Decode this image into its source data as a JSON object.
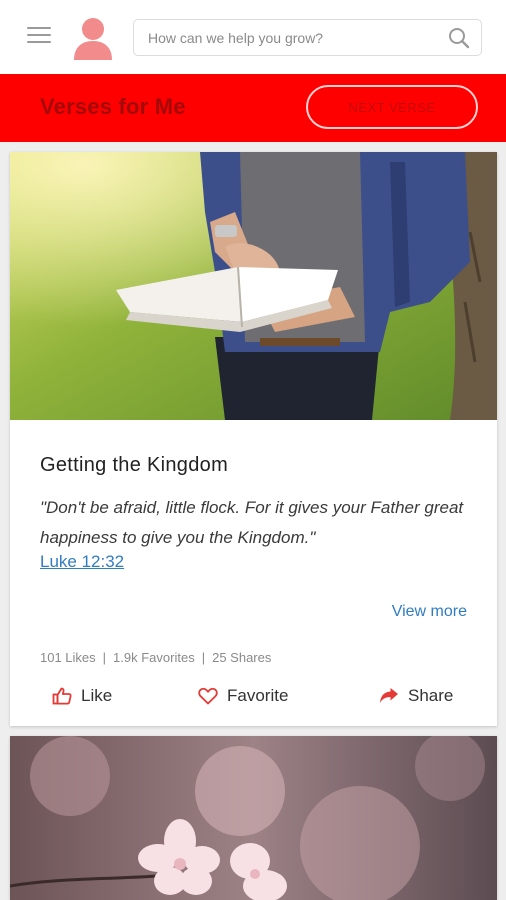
{
  "header": {
    "search_placeholder": "How can we help you grow?"
  },
  "banner": {
    "title": "Verses for Me",
    "next_label": "NEXT VERSE"
  },
  "card": {
    "title": "Getting the Kingdom",
    "quote": "\"Don't be afraid, little flock. For it gives your Father great happiness to give you the Kingdom.\"",
    "reference": "Luke 12:32",
    "view_more": "View more",
    "stats": {
      "likes": "101 Likes",
      "favorites": "1.9k Favorites",
      "shares": "25 Shares",
      "separator": "|"
    },
    "actions": {
      "like": "Like",
      "favorite": "Favorite",
      "share": "Share"
    }
  },
  "colors": {
    "brand_red": "#ff0000",
    "banner_text": "#a50a0a",
    "link_blue": "#2f7dc3",
    "avatar_pink": "#f28b8b"
  },
  "icons": {
    "menu": "hamburger-menu-icon",
    "avatar": "user-avatar-icon",
    "search": "magnifier-icon",
    "like": "thumbs-up-icon",
    "favorite": "heart-outline-icon",
    "share": "share-arrow-icon"
  }
}
